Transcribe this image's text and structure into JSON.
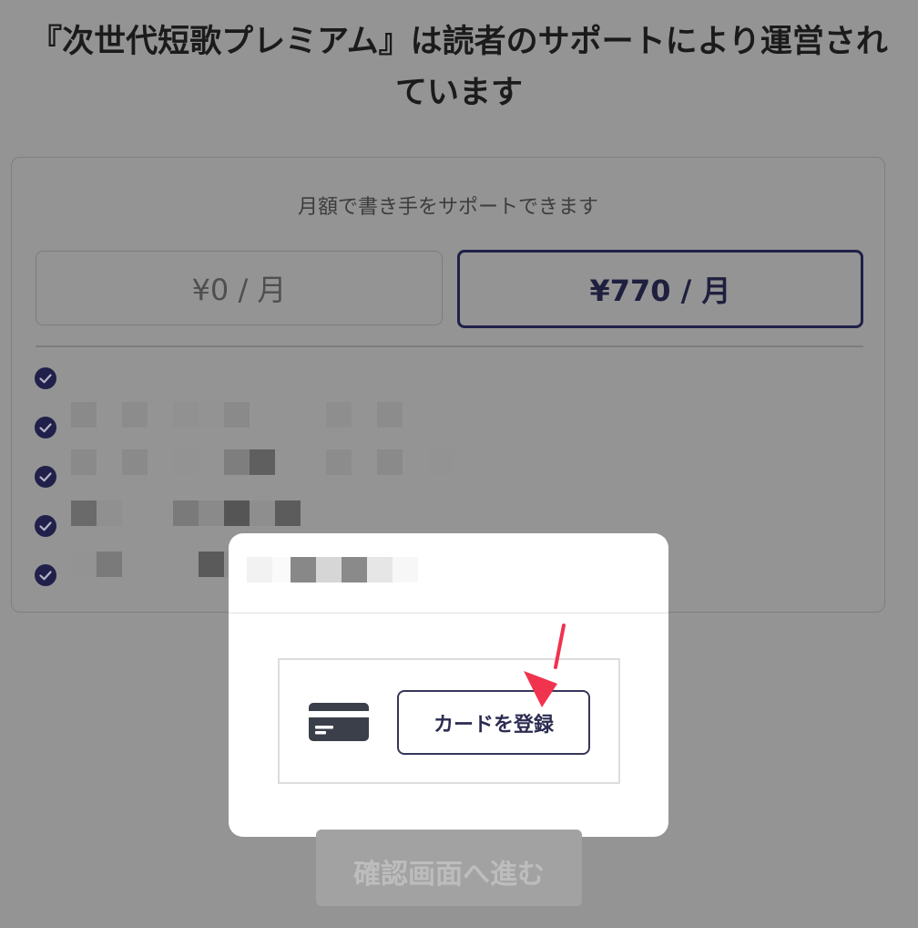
{
  "header": {
    "title": "『次世代短歌プレミアム』は読者のサポートにより運営されています"
  },
  "plan": {
    "subtitle": "月額で書き手をサポートできます",
    "options": [
      {
        "label": "¥0 / 月",
        "selected": false
      },
      {
        "label": "¥770 / 月",
        "selected": true
      }
    ],
    "benefits_count": 5
  },
  "modal": {
    "register_button_label": "カードを登録",
    "card_icon": "credit-card-icon",
    "arrow_icon": "red-pointer-arrow-icon"
  },
  "footer": {
    "confirm_button_label": "確認画面へ進む"
  },
  "colors": {
    "overlay": "#949494",
    "accent_navy": "#20204a",
    "arrow_red": "#f0334e"
  }
}
